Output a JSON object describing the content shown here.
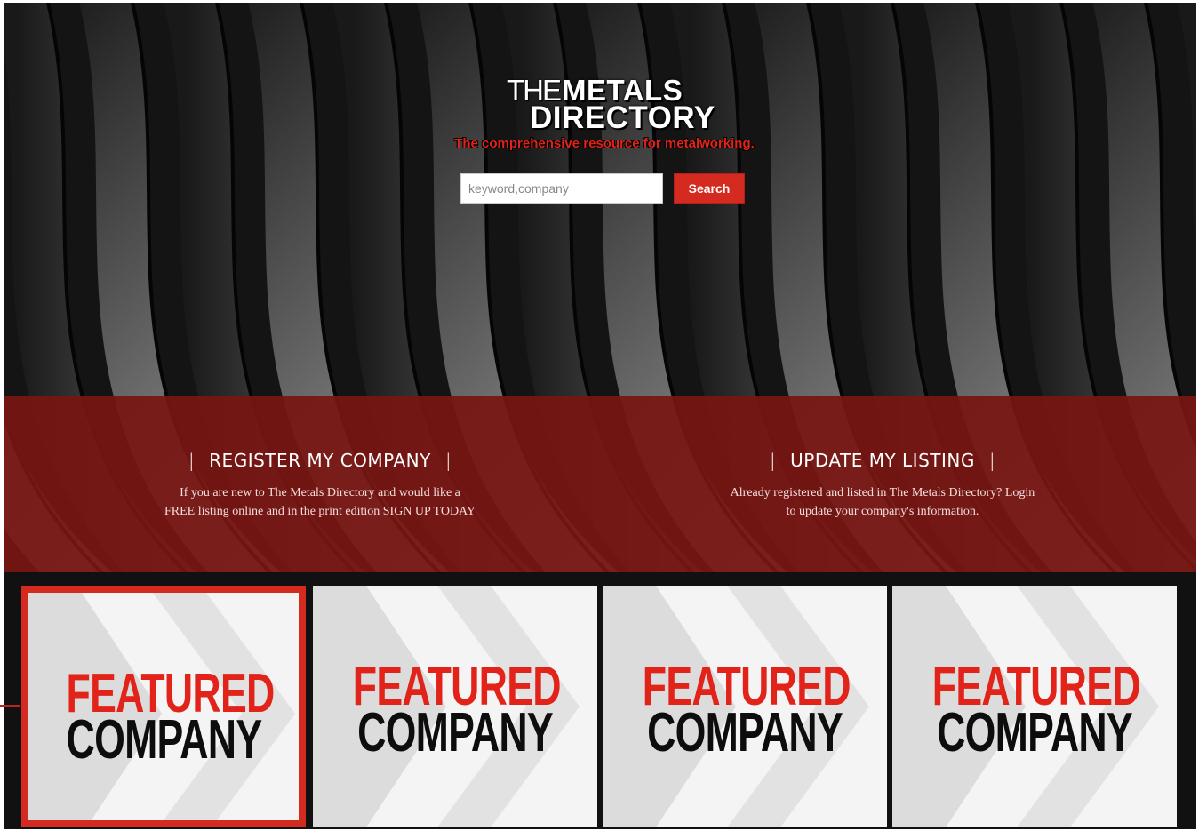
{
  "brand": {
    "logo_the": "THE",
    "logo_metals": "METALS",
    "logo_directory": "DIRECTORY",
    "tagline": "The comprehensive resource for metalworking."
  },
  "search": {
    "placeholder": "keyword,company",
    "value": "",
    "button_label": "Search"
  },
  "actions": {
    "register": {
      "label": "REGISTER MY COMPANY",
      "description_line1": "If you are new to The Metals Directory and would like a",
      "description_line2": "FREE listing online and in the print edition SIGN UP TODAY"
    },
    "update": {
      "label": "UPDATE MY LISTING",
      "description_line1": "Already registered and listed in The Metals Directory? Login",
      "description_line2": "to update your company's information."
    },
    "separator": "|"
  },
  "featured": [
    {
      "line1": "FEATURED",
      "line2": "COMPANY",
      "selected": true
    },
    {
      "line1": "FEATURED",
      "line2": "COMPANY",
      "selected": false
    },
    {
      "line1": "FEATURED",
      "line2": "COMPANY",
      "selected": false
    },
    {
      "line1": "FEATURED",
      "line2": "COMPANY",
      "selected": false
    }
  ],
  "colors": {
    "brand_red": "#e2231a",
    "band_red": "#781612",
    "tile_bg": "#f4f4f4"
  }
}
